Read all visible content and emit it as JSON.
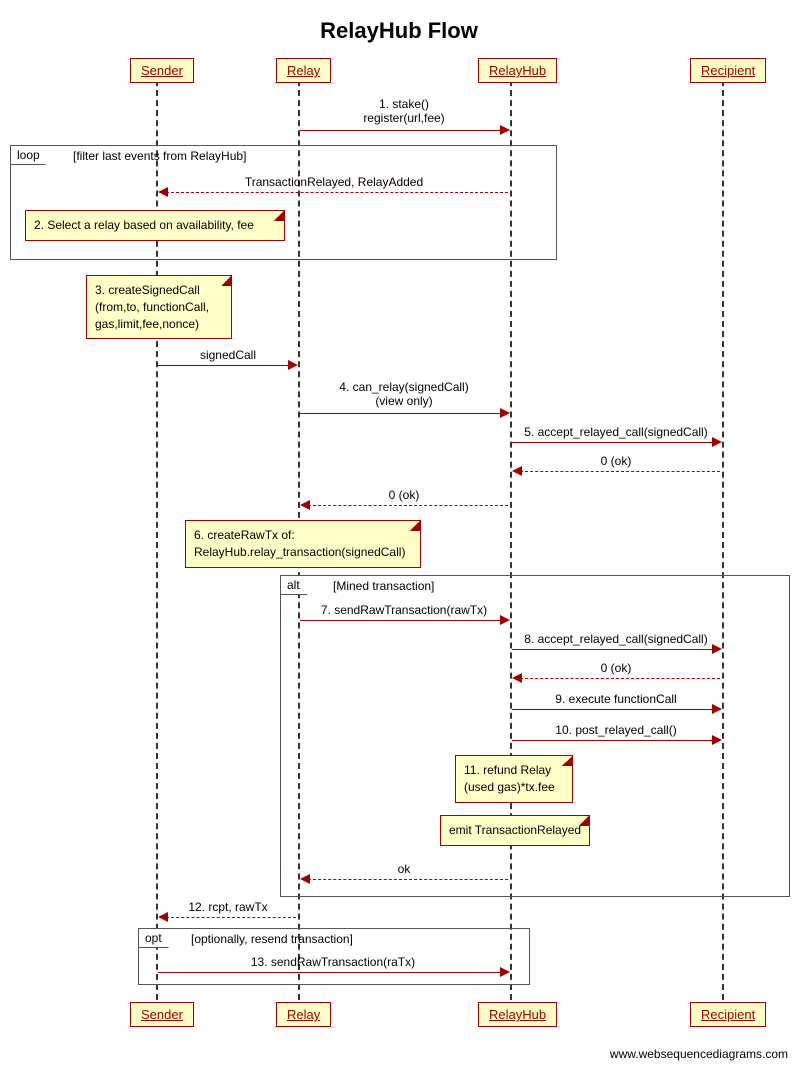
{
  "title": "RelayHub Flow",
  "footer": "www.websequencediagrams.com",
  "actors": {
    "sender": "Sender",
    "relay": "Relay",
    "relayhub": "RelayHub",
    "recipient": "Recipient"
  },
  "frames": {
    "loop": {
      "label": "loop",
      "text": "[filter last events from RelayHub]"
    },
    "alt": {
      "label": "alt",
      "text": "[Mined transaction]"
    },
    "opt": {
      "label": "opt",
      "text": "[optionally, resend transaction]"
    }
  },
  "messages": {
    "m1a": "1. stake()",
    "m1b": "register(url,fee)",
    "m2": "TransactionRelayed, RelayAdded",
    "m3": "signedCall",
    "m4a": "4. can_relay(signedCall)",
    "m4b": "(view only)",
    "m5": "5. accept_relayed_call(signedCall)",
    "m6": "0 (ok)",
    "m7": "0 (ok)",
    "m8": "7. sendRawTransaction(rawTx)",
    "m9": "8. accept_relayed_call(signedCall)",
    "m10": "0 (ok)",
    "m11": "9. execute functionCall",
    "m12": "10. post_relayed_call()",
    "m13": "ok",
    "m14": "12. rcpt, rawTx",
    "m15": "13. sendRawTransaction(raTx)"
  },
  "notes": {
    "n1": "2. Select a relay based on availability, fee",
    "n2a": "3. createSignedCall",
    "n2b": "(from,to, functionCall,",
    "n2c": "gas,limit,fee,nonce)",
    "n3a": "6. createRawTx of:",
    "n3b": "RelayHub.relay_transaction(signedCall)",
    "n4a": "11. refund Relay",
    "n4b": "(used gas)*tx.fee",
    "n5": "emit TransactionRelayed"
  },
  "chart_data": {
    "type": "sequence-diagram",
    "title": "RelayHub Flow",
    "participants": [
      "Sender",
      "Relay",
      "RelayHub",
      "Recipient"
    ],
    "interactions": [
      {
        "from": "Relay",
        "to": "RelayHub",
        "label": "1. stake() register(url,fee)",
        "style": "solid"
      },
      {
        "frame": "loop",
        "condition": "filter last events from RelayHub",
        "contents": [
          {
            "from": "RelayHub",
            "to": "Sender",
            "label": "TransactionRelayed, RelayAdded",
            "style": "dashed"
          },
          {
            "note_over": "Sender",
            "text": "2. Select a relay based on availability, fee"
          }
        ]
      },
      {
        "note_over": "Sender",
        "text": "3. createSignedCall (from,to, functionCall, gas,limit,fee,nonce)"
      },
      {
        "from": "Sender",
        "to": "Relay",
        "label": "signedCall",
        "style": "solid"
      },
      {
        "from": "Relay",
        "to": "RelayHub",
        "label": "4. can_relay(signedCall) (view only)",
        "style": "solid"
      },
      {
        "from": "RelayHub",
        "to": "Recipient",
        "label": "5. accept_relayed_call(signedCall)",
        "style": "solid"
      },
      {
        "from": "Recipient",
        "to": "RelayHub",
        "label": "0 (ok)",
        "style": "dashed"
      },
      {
        "from": "RelayHub",
        "to": "Relay",
        "label": "0 (ok)",
        "style": "dashed"
      },
      {
        "note_over": "Relay",
        "text": "6. createRawTx of: RelayHub.relay_transaction(signedCall)"
      },
      {
        "frame": "alt",
        "condition": "Mined transaction",
        "contents": [
          {
            "from": "Relay",
            "to": "RelayHub",
            "label": "7. sendRawTransaction(rawTx)",
            "style": "solid"
          },
          {
            "from": "RelayHub",
            "to": "Recipient",
            "label": "8. accept_relayed_call(signedCall)",
            "style": "solid"
          },
          {
            "from": "Recipient",
            "to": "RelayHub",
            "label": "0 (ok)",
            "style": "dashed"
          },
          {
            "from": "RelayHub",
            "to": "Recipient",
            "label": "9. execute functionCall",
            "style": "solid"
          },
          {
            "from": "RelayHub",
            "to": "Recipient",
            "label": "10. post_relayed_call()",
            "style": "solid"
          },
          {
            "note_over": "RelayHub",
            "text": "11. refund Relay (used gas)*tx.fee"
          },
          {
            "note_over": "RelayHub",
            "text": "emit TransactionRelayed"
          },
          {
            "from": "RelayHub",
            "to": "Relay",
            "label": "ok",
            "style": "dashed"
          }
        ]
      },
      {
        "from": "Relay",
        "to": "Sender",
        "label": "12. rcpt, rawTx",
        "style": "dashed"
      },
      {
        "frame": "opt",
        "condition": "optionally, resend transaction",
        "contents": [
          {
            "from": "Sender",
            "to": "RelayHub",
            "label": "13. sendRawTransaction(raTx)",
            "style": "solid"
          }
        ]
      }
    ]
  }
}
